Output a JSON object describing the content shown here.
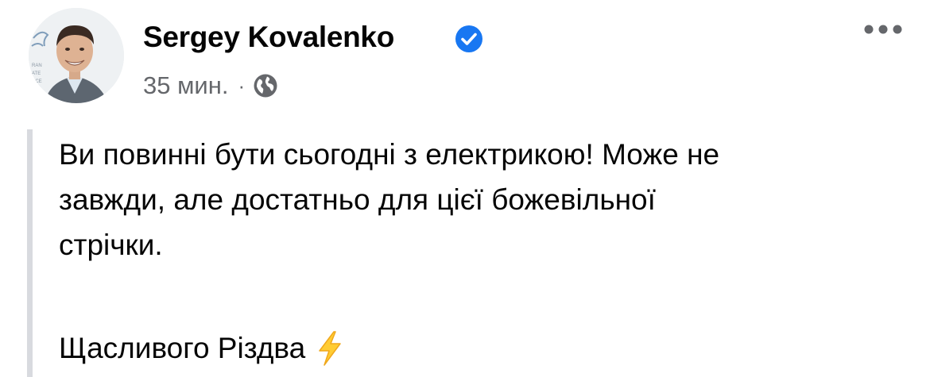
{
  "post": {
    "author": "Sergey Kovalenko",
    "verified": true,
    "timestamp": "35 мин.",
    "separator": "·",
    "privacy_icon": "globe-icon",
    "more_icon": "more-options-icon",
    "avatar_background_text": [
      "RAN",
      "ATE",
      "NCE"
    ],
    "body_lines": [
      "Ви повинні бути сьогодні з електрикою! Може не",
      "завжди, але достатньо для цієї божевільної",
      "стрічки."
    ],
    "greeting": "Щасливого Різдва",
    "greeting_icon": "high-voltage-emoji"
  },
  "colors": {
    "verified_badge": "#1877f2",
    "secondary_text": "#65676b",
    "quote_bar": "#d8dadf",
    "bolt": "#ffcc33"
  }
}
